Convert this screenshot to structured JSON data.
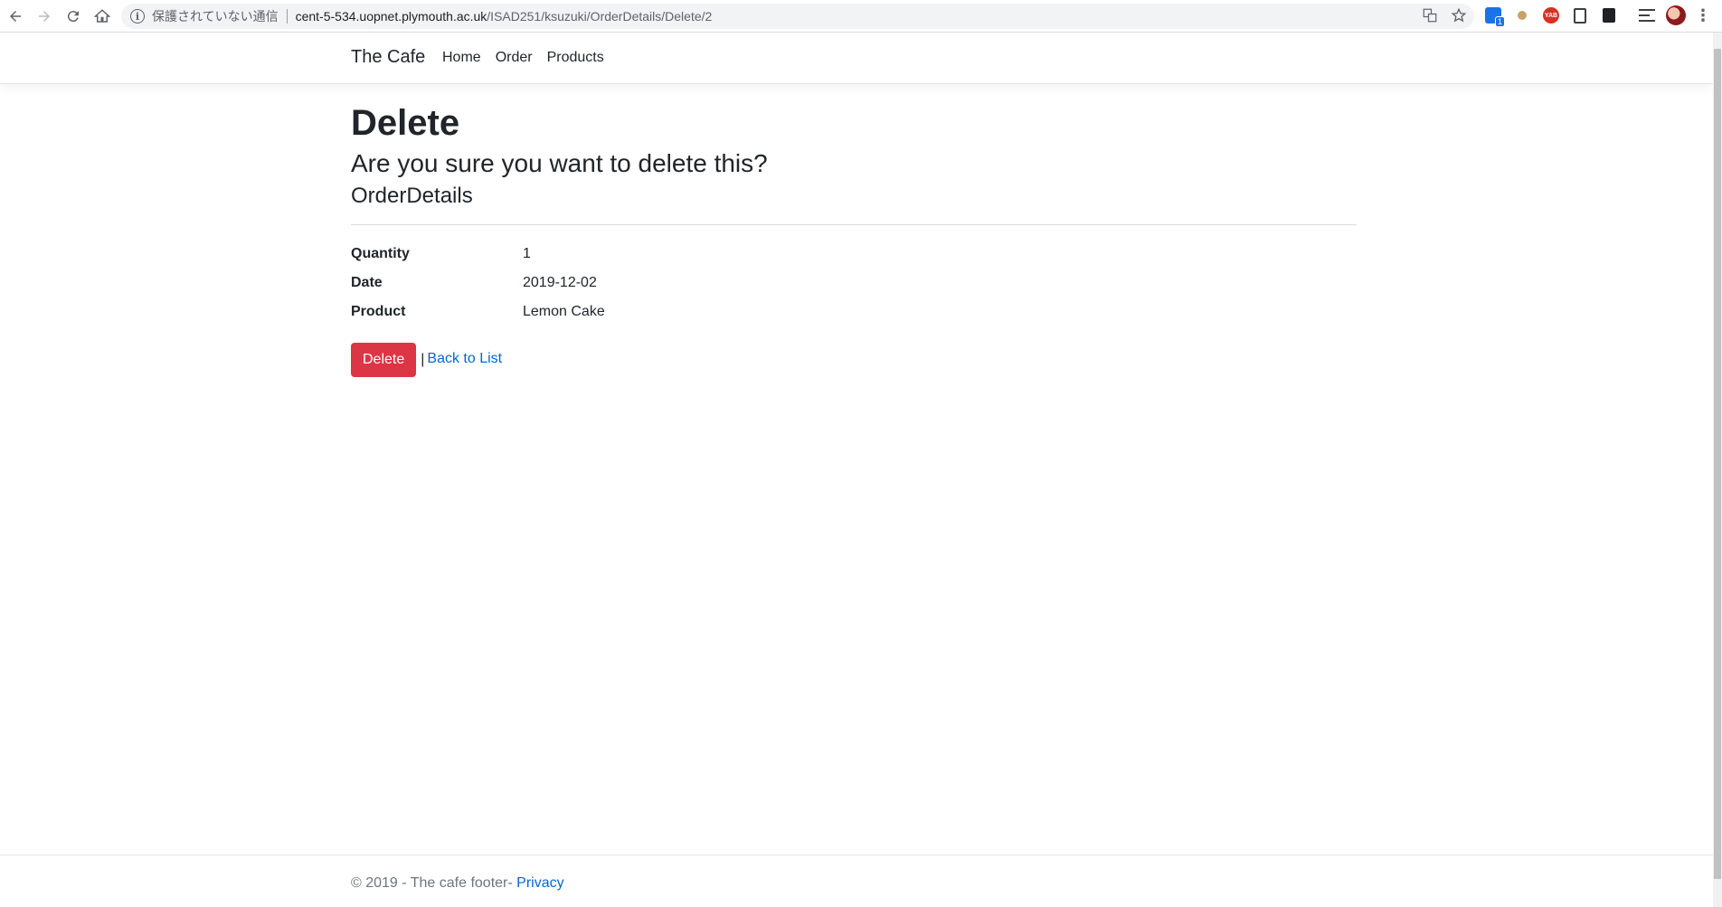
{
  "browser": {
    "security_label": "保護されていない通信",
    "url_host": "cent-5-534.uopnet.plymouth.ac.uk",
    "url_path": "/ISAD251/ksuzuki/OrderDetails/Delete/2",
    "extension_badge": "1",
    "extension_red_label": "YAB"
  },
  "navbar": {
    "brand": "The Cafe",
    "links": [
      "Home",
      "Order",
      "Products"
    ]
  },
  "page": {
    "title": "Delete",
    "question": "Are you sure you want to delete this?",
    "entity": "OrderDetails",
    "fields": [
      {
        "label": "Quantity",
        "value": "1"
      },
      {
        "label": "Date",
        "value": "2019-12-02"
      },
      {
        "label": "Product",
        "value": "Lemon Cake"
      }
    ],
    "delete_button": "Delete",
    "separator": "|",
    "back_link": "Back to List"
  },
  "footer": {
    "text": "© 2019 - The cafe footer- ",
    "privacy_link": "Privacy"
  },
  "colors": {
    "danger": "#dc3545",
    "link": "#0366d6",
    "text": "#212529",
    "muted": "#6c757d"
  }
}
